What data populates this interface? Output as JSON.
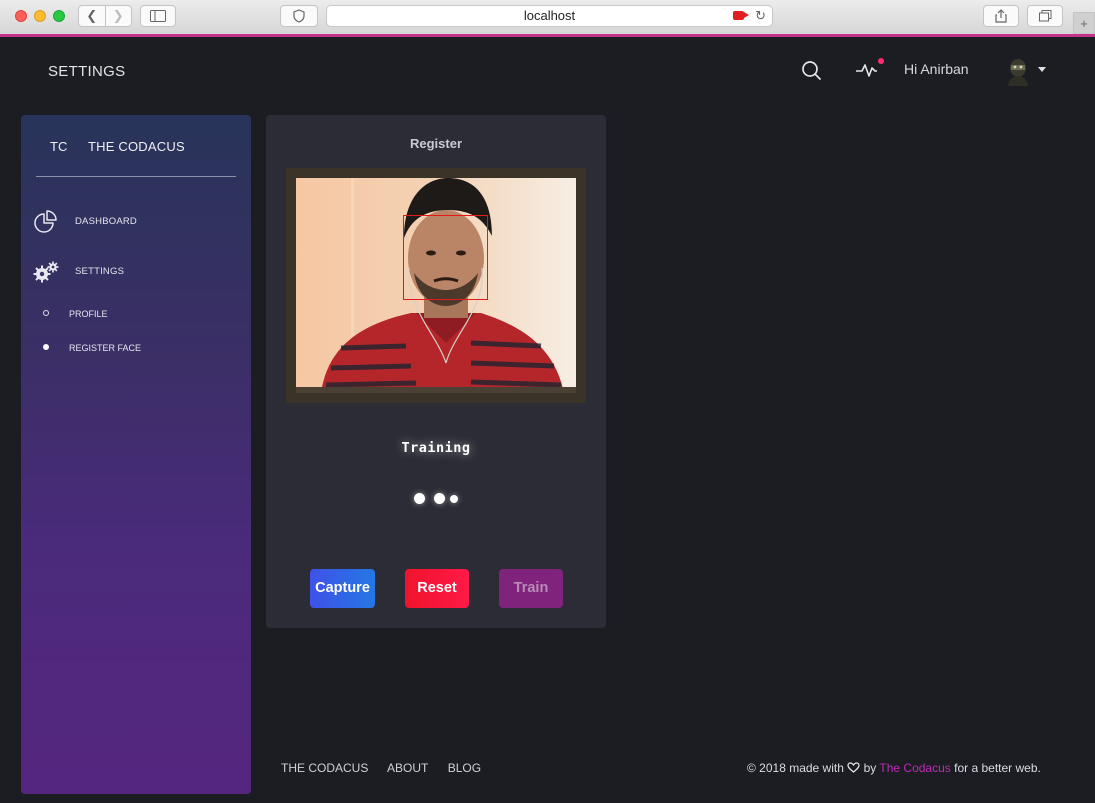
{
  "browser": {
    "url": "localhost"
  },
  "header": {
    "title": "SETTINGS",
    "greeting": "Hi Anirban",
    "icons": [
      "search-icon",
      "activity-icon",
      "avatar",
      "caret-down-icon"
    ],
    "notification_color": "#ff2d6f"
  },
  "sidebar": {
    "brand_abbr": "TC",
    "brand_name": "THE CODACUS",
    "items": [
      {
        "label": "DASHBOARD",
        "icon": "pie-chart-icon"
      },
      {
        "label": "SETTINGS",
        "icon": "gears-icon"
      }
    ],
    "subitems": [
      {
        "label": "PROFILE",
        "active": false
      },
      {
        "label": "REGISTER FACE",
        "active": true
      }
    ]
  },
  "card": {
    "title": "Register",
    "status": "Training",
    "buttons": {
      "capture": "Capture",
      "reset": "Reset",
      "train": "Train"
    }
  },
  "footer": {
    "links": [
      "THE CODACUS",
      "ABOUT",
      "BLOG"
    ],
    "copy_prefix": "© 2018 made with",
    "copy_by": "by",
    "copy_brand": "The Codacus",
    "copy_suffix": "for a better web."
  },
  "colors": {
    "accent_magenta": "#c2328f",
    "capture": "#3e52e8",
    "reset": "#f0132d",
    "train": "#80237c",
    "face_box": "#e21a1a"
  }
}
